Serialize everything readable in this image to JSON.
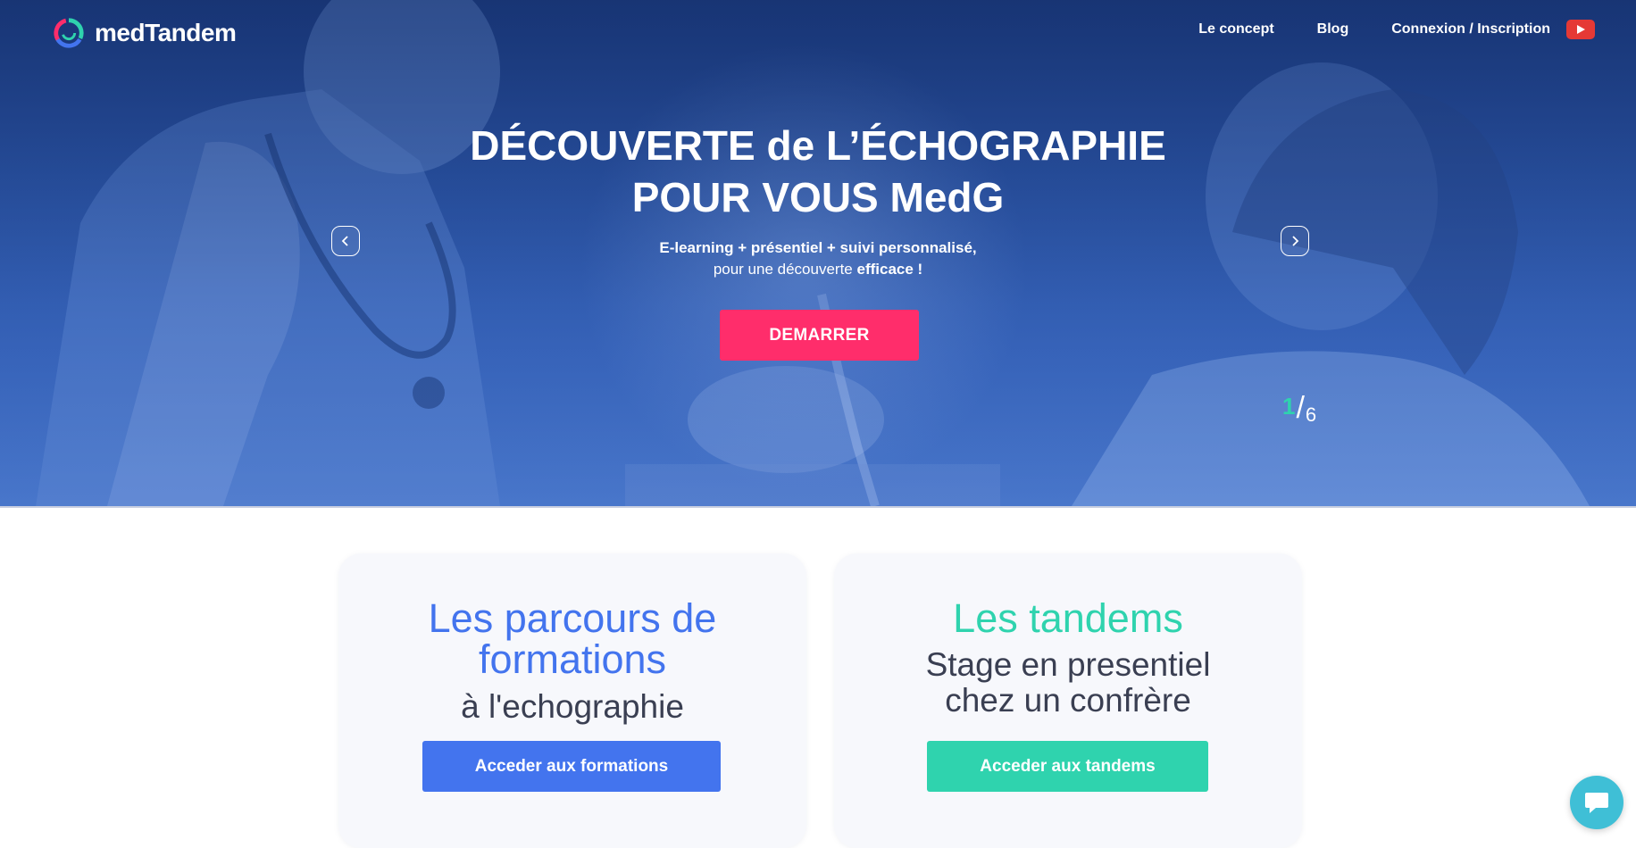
{
  "brand": {
    "name": "medTandem"
  },
  "nav": {
    "items": [
      {
        "label": "Le concept"
      },
      {
        "label": "Blog"
      },
      {
        "label": "Connexion / Inscription"
      }
    ],
    "youtube_icon": "youtube-icon"
  },
  "hero": {
    "title_line1": "DÉCOUVERTE de L’ÉCHOGRAPHIE",
    "title_line2": "POUR VOUS MedG",
    "subtitle_line1": "E-learning + présentiel + suivi personnalisé,",
    "subtitle_line2_prefix": "pour une découverte ",
    "subtitle_line2_bold": "efficace !",
    "cta_label": "DEMARRER",
    "slide_current": "1",
    "slide_separator": "/",
    "slide_total": "6"
  },
  "cards": {
    "formations": {
      "title": "Les parcours de formations",
      "subtitle": "à l'echographie",
      "button_label": "Acceder aux formations"
    },
    "tandems": {
      "title": "Les tandems",
      "subtitle_line1": "Stage en presentiel",
      "subtitle_line2": "chez un confrère",
      "button_label": "Acceder aux tandems"
    }
  },
  "colors": {
    "cta": "#ff2d6b",
    "formations_accent": "#4374ee",
    "tandems_accent": "#2fd3ae",
    "chat": "#3fbfd6",
    "youtube": "#e53935"
  },
  "icons": {
    "prev": "chevron-left-icon",
    "next": "chevron-right-icon",
    "chat": "chat-bubble-icon"
  }
}
